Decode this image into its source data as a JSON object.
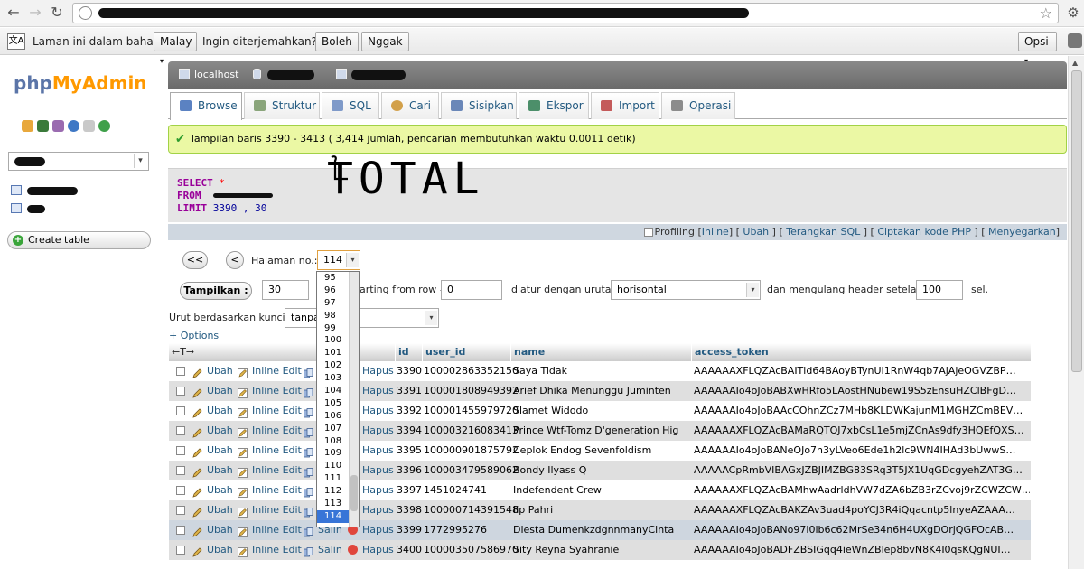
{
  "browser": {
    "translate_bar": {
      "prefix": "Laman ini dalam bahasa",
      "language": "Malay",
      "question": "Ingin diterjemahkan?",
      "yes_button": "Boleh",
      "no_button": "Nggak",
      "options_button": "Opsi"
    }
  },
  "nav": {
    "logo_php": "php",
    "logo_myadmin": "MyAdmin",
    "create_table": "Create table"
  },
  "breadcrumb": {
    "server": "localhost"
  },
  "tabs": [
    {
      "label": "Browse"
    },
    {
      "label": "Struktur"
    },
    {
      "label": "SQL"
    },
    {
      "label": "Cari"
    },
    {
      "label": "Sisipkan"
    },
    {
      "label": "Ekspor"
    },
    {
      "label": "Import"
    },
    {
      "label": "Operasi"
    }
  ],
  "success_message": "Tampilan baris 3390 - 3413 ( 3,414 jumlah, pencarian membutuhkan waktu 0.0011 detik)",
  "sql": {
    "select": "SELECT",
    "star": "*",
    "from": "FROM",
    "limit": "LIMIT",
    "limit_values": "3390 , 30"
  },
  "annotation": "TOTAL",
  "profiling": {
    "label": "Profiling",
    "inline": "Inline",
    "ubah": "Ubah",
    "terangkan": "Terangkan SQL",
    "ciptakan": "Ciptakan kode PHP",
    "menyegarkan": "Menyegarkan"
  },
  "pager": {
    "first": "<<",
    "prev": "<",
    "label": "Halaman no.:",
    "current": "114",
    "options": [
      "95",
      "96",
      "97",
      "98",
      "99",
      "100",
      "101",
      "102",
      "103",
      "104",
      "105",
      "106",
      "107",
      "108",
      "109",
      "110",
      "111",
      "112",
      "113",
      "114"
    ]
  },
  "display": {
    "button": "Tampilkan :",
    "rows": "30",
    "starting_label": "arting from row #",
    "start_value": "0",
    "order_label": "diatur dengan urutan",
    "order_value": "horisontal",
    "repeat_label": "dan mengulang header setelah",
    "repeat_value": "100",
    "cells_label": "sel.",
    "sort_label": "Urut berdasarkan kunci:",
    "sort_value": "tanpa",
    "options_link": "+ Options",
    "arrows": "←T→"
  },
  "table": {
    "columns": [
      "id",
      "user_id",
      "name",
      "access_token"
    ],
    "actions": {
      "edit": "Ubah",
      "inline": "Inline Edit",
      "copy": "Salin",
      "delete": "Hapus"
    },
    "rows": [
      {
        "id": "3390",
        "user_id": "100002863352150",
        "name": "Saya Tidak",
        "token": "AAAAAAXFLQZAcBAITld64BAoyBTynUI1RnW4qb7AjAjeOGVZBP…"
      },
      {
        "id": "3391",
        "user_id": "100001808949392",
        "name": "Arief Dhika Menunggu Juminten",
        "token": "AAAAAAIo4oJoBABXwHRfo5LAostHNubew19S5zEnsuHZClBFgD…"
      },
      {
        "id": "3392",
        "user_id": "100001455979720",
        "name": "Slamet Widodo",
        "token": "AAAAAAIo4oJoBAAcCOhnZCz7MHb8KLDWKajunM1MGHZCmBEV…"
      },
      {
        "id": "3394",
        "user_id": "100003216083413",
        "name": "Prince Wtf-Tomz D'generation Hig",
        "token": "AAAAAAXFLQZAcBAMaRQTOJ7xbCsL1e5mjZCnAs9dfy3HQEfQXS…"
      },
      {
        "id": "3395",
        "user_id": "100000901875792",
        "name": "Ceplok Endog Sevenfoldism",
        "token": "AAAAAAIo4oJoBANeOJo7h3yLVeo6Ede1h2lc9WN4IHAd3bUwwS…"
      },
      {
        "id": "3396",
        "user_id": "100003479589062",
        "name": "Bondy Ilyass Q",
        "token": "AAAAACpRmbVIBAGxJZBJIMZBG83SRq3T5JX1UqGDcgyehZAT3G…"
      },
      {
        "id": "3397",
        "user_id": "1451024741",
        "name": "Indefendent Crew",
        "token": "AAAAAAXFLQZAcBAMhwAadrldhVW7dZA6bZB3rZCvoj9rZCWZCW…"
      },
      {
        "id": "3398",
        "user_id": "100000714391548",
        "name": "Iip Pahri",
        "token": "AAAAAAXFLQZAcBAKZAv3uad4poYCJ3R4iQqacntp5lnyeAZAAA…"
      },
      {
        "id": "3399",
        "user_id": "1772995276",
        "name": "Diesta DumenkzdgnnmanyCinta",
        "token": "AAAAAAIo4oJoBANo97i0ib6c62MrSe34n6H4UXgDOrjQGFOcAB…"
      },
      {
        "id": "3400",
        "user_id": "100003507586970",
        "name": "Sity Reyna Syahranie",
        "token": "AAAAAAIo4oJoBADFZBSIGqq4ieWnZBlep8bvN8K4I0qsKQgNUI…"
      }
    ]
  },
  "colors": {
    "link": "#235a81",
    "success_bg": "#ebf8a4",
    "sql_keyword": "#990099",
    "row_even": "#dfdfdf",
    "row_marked": "#ced6df"
  }
}
